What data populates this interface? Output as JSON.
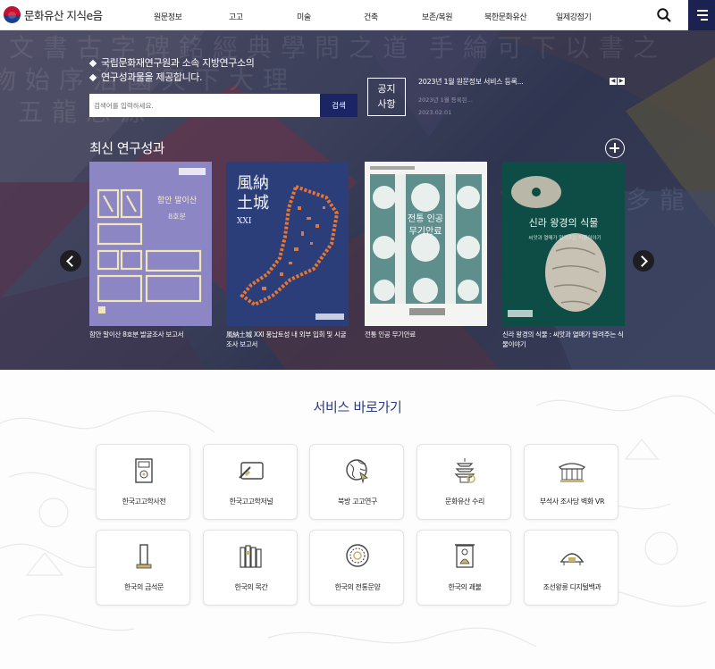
{
  "header": {
    "logo_text": "문화유산 지식e음",
    "nav": [
      "원문정보",
      "고고",
      "미술",
      "건축",
      "보존/복원",
      "북한문화유산",
      "일제강점기"
    ]
  },
  "hero": {
    "intro_line1": "국립문화재연구원과 소속 지방연구소의",
    "intro_line2": "연구성과물을 제공합니다.",
    "search_placeholder": "검색어를 입력하세요.",
    "search_button": "검색",
    "notice_label_1": "공지",
    "notice_label_2": "사항",
    "notice_title": "2023년 1월 원문정보 서비스 등록...",
    "notice_sub": "2023년 1월 등록된...",
    "notice_date": "2023.02.01",
    "latest_title": "최신 연구성과",
    "books": [
      {
        "caption": "함안 말이산 8호분 발굴조사 보고서",
        "cover_title": "함안 말이산",
        "cover_sub": "8호분"
      },
      {
        "caption": "風納土城 XXI 풍납토성 내 외부 입회 및 시굴조사 보고서",
        "cover_title": "風納\n土城",
        "cover_sub": "XXI"
      },
      {
        "caption": "전통 인공 무기안료",
        "cover_title": "전통 인공 무기안료",
        "cover_sub": ""
      },
      {
        "caption": "신라 왕경의 식물 : 씨앗과 열매가 알려주는 식물이야기",
        "cover_title": "신라 왕경의 식물",
        "cover_sub": "씨앗과 열매가 알려주는 식물이야기"
      }
    ]
  },
  "services": {
    "title": "서비스 바로가기",
    "items": [
      {
        "label": "한국고고학사전",
        "icon": "book-icon"
      },
      {
        "label": "한국고고학저널",
        "icon": "scroll-icon"
      },
      {
        "label": "북방 고고연구",
        "icon": "globe-icon"
      },
      {
        "label": "문화유산 수리",
        "icon": "pagoda-icon"
      },
      {
        "label": "부석사 조사당 벽화 VR",
        "icon": "hall-icon"
      },
      {
        "label": "한국의 금석문",
        "icon": "stele-icon"
      },
      {
        "label": "한국의 목간",
        "icon": "wooden-slips-icon"
      },
      {
        "label": "한국의 전통문양",
        "icon": "pattern-icon"
      },
      {
        "label": "한국의 괘불",
        "icon": "buddha-painting-icon"
      },
      {
        "label": "조선왕릉 디지털백과",
        "icon": "tomb-icon"
      }
    ]
  },
  "colors": {
    "navy": "#1c2563",
    "title_blue": "#2b3a86",
    "book1": "#8d86c4",
    "book2": "#2b3e7a",
    "book4": "#0d4d45"
  }
}
